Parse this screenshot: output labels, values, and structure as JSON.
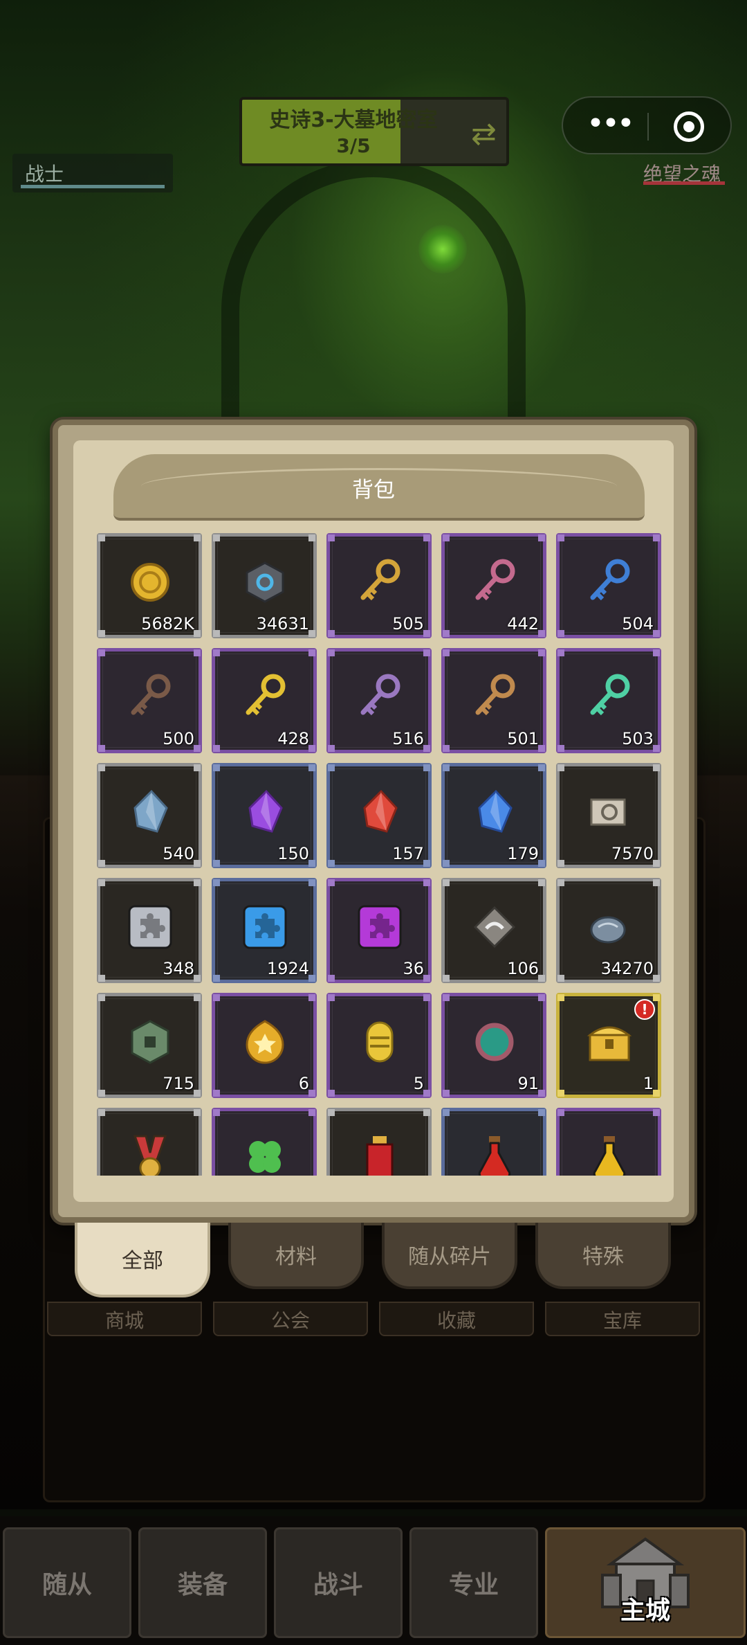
{
  "hud": {
    "dungeon_title": "史诗3-大墓地密室",
    "dungeon_progress": "3/5",
    "progress_value": 0.6,
    "hero_name": "战士",
    "enemy_name": "绝望之魂"
  },
  "background_tabs": [
    "商城",
    "公会",
    "收藏",
    "宝库"
  ],
  "backpack": {
    "title": "背包",
    "items": [
      {
        "icon": "gold-coin-icon",
        "rarity": "gray",
        "count": "5682K"
      },
      {
        "icon": "hex-gem-icon",
        "rarity": "gray",
        "count": "34631"
      },
      {
        "icon": "gold-key-icon",
        "rarity": "purple",
        "count": "505"
      },
      {
        "icon": "pink-key-icon",
        "rarity": "purple",
        "count": "442"
      },
      {
        "icon": "blue-key-icon",
        "rarity": "purple",
        "count": "504"
      },
      {
        "icon": "bronze-key-icon",
        "rarity": "purple",
        "count": "500"
      },
      {
        "icon": "ornate-gold-key-icon",
        "rarity": "purple",
        "count": "428"
      },
      {
        "icon": "violet-key-icon",
        "rarity": "purple",
        "count": "516"
      },
      {
        "icon": "copper-key-icon",
        "rarity": "purple",
        "count": "501"
      },
      {
        "icon": "jade-key-icon",
        "rarity": "purple",
        "count": "503"
      },
      {
        "icon": "mixed-crystal-icon",
        "rarity": "gray",
        "count": "540"
      },
      {
        "icon": "purple-crystal-icon",
        "rarity": "blue",
        "count": "150"
      },
      {
        "icon": "red-crystal-icon",
        "rarity": "blue",
        "count": "157"
      },
      {
        "icon": "blue-crystal-icon",
        "rarity": "blue",
        "count": "179"
      },
      {
        "icon": "scroll-icon",
        "rarity": "gray",
        "count": "7570"
      },
      {
        "icon": "silver-puzzle-piece-icon",
        "rarity": "gray",
        "count": "348"
      },
      {
        "icon": "blue-puzzle-piece-icon",
        "rarity": "blue",
        "count": "1924"
      },
      {
        "icon": "purple-puzzle-piece-icon",
        "rarity": "purple",
        "count": "36"
      },
      {
        "icon": "swirl-stone-icon",
        "rarity": "gray",
        "count": "106"
      },
      {
        "icon": "fish-fossil-icon",
        "rarity": "gray",
        "count": "34270"
      },
      {
        "icon": "jade-coin-icon",
        "rarity": "gray",
        "count": "715"
      },
      {
        "icon": "gold-star-badge-icon",
        "rarity": "purple",
        "count": "6"
      },
      {
        "icon": "gold-capsule-icon",
        "rarity": "purple",
        "count": "5"
      },
      {
        "icon": "teal-orb-icon",
        "rarity": "purple",
        "count": "91"
      },
      {
        "icon": "treasure-chest-icon",
        "rarity": "gold",
        "count": "1",
        "alert": "!"
      },
      {
        "icon": "medal-icon",
        "rarity": "gray",
        "count": ""
      },
      {
        "icon": "clover-icon",
        "rarity": "purple",
        "count": ""
      },
      {
        "icon": "red-potion-bottle-icon",
        "rarity": "gray",
        "count": ""
      },
      {
        "icon": "red-flask-icon",
        "rarity": "blue",
        "count": ""
      },
      {
        "icon": "gold-flask-icon",
        "rarity": "purple",
        "count": ""
      }
    ]
  },
  "tabs": [
    "全部",
    "材料",
    "随从碎片",
    "特殊"
  ],
  "active_tab": 0,
  "bottom_nav": [
    "随从",
    "装备",
    "战斗",
    "专业",
    "主城"
  ]
}
